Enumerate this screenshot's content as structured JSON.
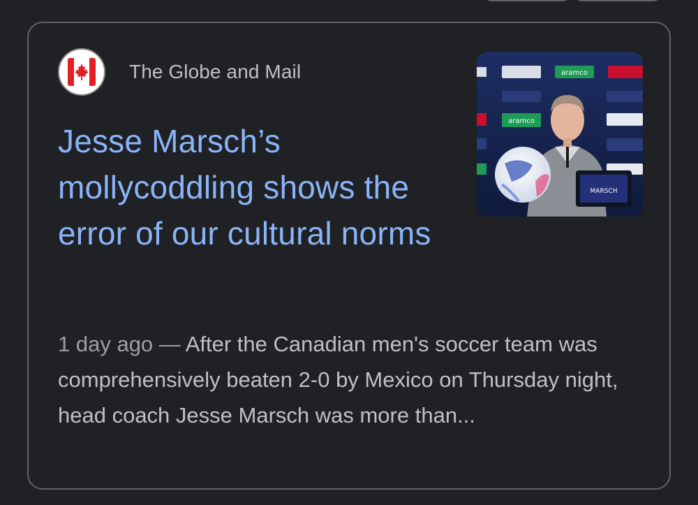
{
  "result": {
    "source": {
      "name": "The Globe and Mail",
      "favicon_icon": "maple-leaf-icon",
      "favicon_color": "#e31e24"
    },
    "headline": "Jesse Marsch’s mollycoddling shows the error of our cultural norms",
    "date": "1 day ago",
    "separator": " — ",
    "snippet": "After the Canadian men's soccer team was comprehensively beaten 2-0 by Mexico on Thursday night, head coach Jesse Marsch was more than...",
    "thumbnail": {
      "subject": "press-conference-photo",
      "sponsor_banners": [
        "aramco",
        "aramco"
      ]
    }
  },
  "colors": {
    "background": "#202124",
    "card_border": "#5f6368",
    "link": "#8ab4f8",
    "text": "#bdc1c6",
    "muted_text": "#9aa0a6"
  }
}
